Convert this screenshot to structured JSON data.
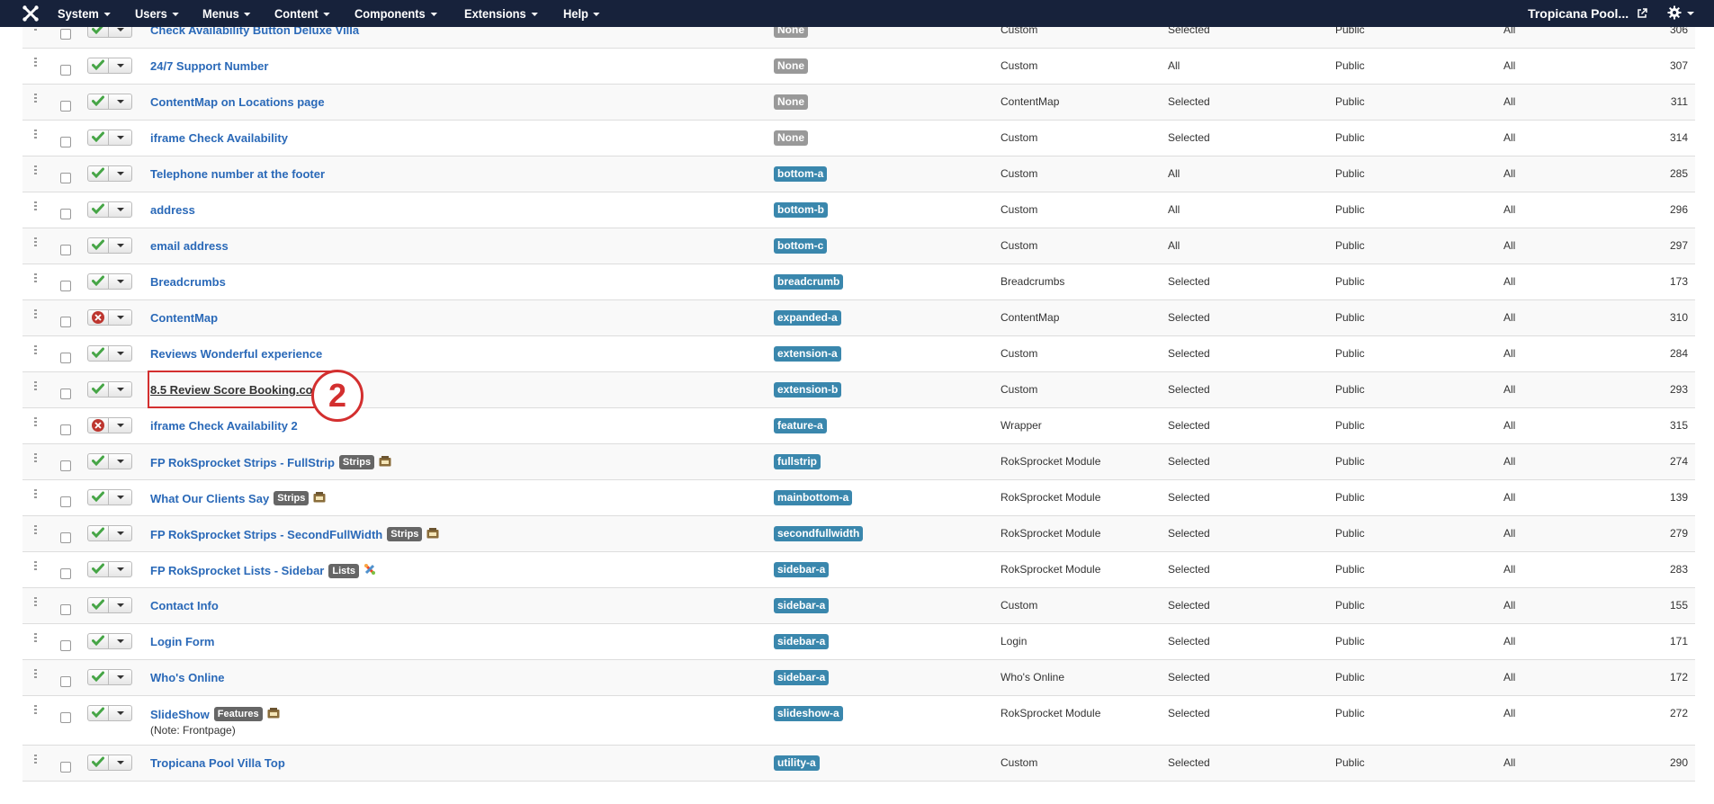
{
  "nav": {
    "menu": [
      {
        "label": "System"
      },
      {
        "label": "Users"
      },
      {
        "label": "Menus"
      },
      {
        "label": "Content"
      },
      {
        "label": "Components"
      },
      {
        "label": "Extensions"
      },
      {
        "label": "Help"
      }
    ],
    "site_link": "Tropicana Pool...",
    "icons": {
      "logo": "joomla-logo-icon",
      "external": "external-link-icon",
      "settings": "gear-icon"
    }
  },
  "modules": [
    {
      "title": "Check Availability Button Deluxe Villa",
      "published": true,
      "position": "None",
      "type": "Custom",
      "pages": "Selected",
      "access": "Public",
      "language": "All",
      "id": "306"
    },
    {
      "title": "24/7 Support Number",
      "published": true,
      "position": "None",
      "type": "Custom",
      "pages": "All",
      "access": "Public",
      "language": "All",
      "id": "307"
    },
    {
      "title": "ContentMap on Locations page",
      "published": true,
      "position": "None",
      "type": "ContentMap",
      "pages": "Selected",
      "access": "Public",
      "language": "All",
      "id": "311"
    },
    {
      "title": "iframe Check Availability",
      "published": true,
      "position": "None",
      "type": "Custom",
      "pages": "Selected",
      "access": "Public",
      "language": "All",
      "id": "314"
    },
    {
      "title": "Telephone number at the footer",
      "published": true,
      "position": "bottom-a",
      "type": "Custom",
      "pages": "All",
      "access": "Public",
      "language": "All",
      "id": "285"
    },
    {
      "title": "address",
      "published": true,
      "position": "bottom-b",
      "type": "Custom",
      "pages": "All",
      "access": "Public",
      "language": "All",
      "id": "296"
    },
    {
      "title": "email address",
      "published": true,
      "position": "bottom-c",
      "type": "Custom",
      "pages": "All",
      "access": "Public",
      "language": "All",
      "id": "297"
    },
    {
      "title": "Breadcrumbs",
      "published": true,
      "position": "breadcrumb",
      "type": "Breadcrumbs",
      "pages": "Selected",
      "access": "Public",
      "language": "All",
      "id": "173"
    },
    {
      "title": "ContentMap",
      "published": false,
      "position": "expanded-a",
      "type": "ContentMap",
      "pages": "Selected",
      "access": "Public",
      "language": "All",
      "id": "310"
    },
    {
      "title": "Reviews Wonderful experience",
      "published": true,
      "position": "extension-a",
      "type": "Custom",
      "pages": "Selected",
      "access": "Public",
      "language": "All",
      "id": "284"
    },
    {
      "title": "8.5 Review Score Booking.com",
      "published": true,
      "position": "extension-b",
      "type": "Custom",
      "pages": "Selected",
      "access": "Public",
      "language": "All",
      "id": "293"
    },
    {
      "title": "iframe Check Availability 2",
      "published": false,
      "position": "feature-a",
      "type": "Wrapper",
      "pages": "Selected",
      "access": "Public",
      "language": "All",
      "id": "315"
    },
    {
      "title": "FP RokSprocket Strips - FullStrip",
      "badge": "Strips",
      "published": true,
      "position": "fullstrip",
      "type": "RokSprocket Module",
      "pages": "Selected",
      "access": "Public",
      "language": "All",
      "id": "274"
    },
    {
      "title": "What Our Clients Say",
      "badge": "Strips",
      "published": true,
      "position": "mainbottom-a",
      "type": "RokSprocket Module",
      "pages": "Selected",
      "access": "Public",
      "language": "All",
      "id": "139"
    },
    {
      "title": "FP RokSprocket Strips - SecondFullWidth",
      "badge": "Strips",
      "published": true,
      "position": "secondfullwidth",
      "type": "RokSprocket Module",
      "pages": "Selected",
      "access": "Public",
      "language": "All",
      "id": "279"
    },
    {
      "title": "FP RokSprocket Lists - Sidebar",
      "badge": "Lists",
      "published": true,
      "position": "sidebar-a",
      "type": "RokSprocket Module",
      "pages": "Selected",
      "access": "Public",
      "language": "All",
      "id": "283"
    },
    {
      "title": "Contact Info",
      "published": true,
      "position": "sidebar-a",
      "type": "Custom",
      "pages": "Selected",
      "access": "Public",
      "language": "All",
      "id": "155"
    },
    {
      "title": "Login Form",
      "published": true,
      "position": "sidebar-a",
      "type": "Login",
      "pages": "Selected",
      "access": "Public",
      "language": "All",
      "id": "171"
    },
    {
      "title": "Who's Online",
      "published": true,
      "position": "sidebar-a",
      "type": "Who's Online",
      "pages": "Selected",
      "access": "Public",
      "language": "All",
      "id": "172"
    },
    {
      "title": "SlideShow",
      "badge": "Features",
      "note": "(Note: Frontpage)",
      "published": true,
      "position": "slideshow-a",
      "type": "RokSprocket Module",
      "pages": "Selected",
      "access": "Public",
      "language": "All",
      "id": "272"
    },
    {
      "title": "Tropicana Pool Villa Top",
      "published": true,
      "position": "utility-a",
      "type": "Custom",
      "pages": "Selected",
      "access": "Public",
      "language": "All",
      "id": "290"
    }
  ],
  "annotation": {
    "number": "2"
  },
  "colors": {
    "navbar": "#17223b",
    "link": "#2a69b8",
    "position_label": "#3a87ad",
    "position_none": "#999999",
    "published": "#46a546",
    "unpublished": "#bd362f",
    "annotation": "#d32f2f"
  }
}
